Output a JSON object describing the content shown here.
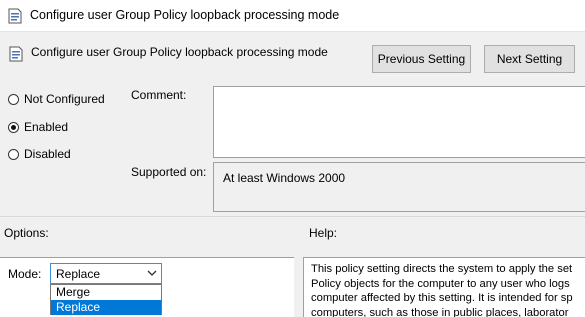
{
  "window": {
    "title": "Configure user Group Policy loopback processing mode"
  },
  "header": {
    "policy_name": "Configure user Group Policy loopback processing mode",
    "prev_button": "Previous Setting",
    "next_button": "Next Setting"
  },
  "state": {
    "options": [
      {
        "label": "Not Configured",
        "checked": false
      },
      {
        "label": "Enabled",
        "checked": true
      },
      {
        "label": "Disabled",
        "checked": false
      }
    ]
  },
  "comment": {
    "label": "Comment:",
    "value": ""
  },
  "supported": {
    "label": "Supported on:",
    "value": "At least Windows 2000"
  },
  "options_section": {
    "label": "Options:",
    "mode_label": "Mode:",
    "mode_value": "Replace",
    "dropdown_options": [
      "Merge",
      "Replace"
    ],
    "highlighted_option": "Replace"
  },
  "help_section": {
    "label": "Help:",
    "lines": [
      "This policy setting directs the system to apply the set",
      "Policy objects for the computer to any user who logs",
      "computer affected by this setting. It is intended for sp",
      "computers, such as those in public places, laborator"
    ]
  },
  "colors": {
    "accent": "#0078d7",
    "focus_border": "#3c8fd8",
    "dialog_bg": "#f0f0f0"
  },
  "icons": {
    "policy": "policy-setting-icon",
    "dropdown": "chevron-down-icon"
  }
}
